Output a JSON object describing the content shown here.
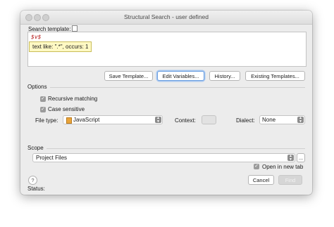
{
  "window": {
    "title": "Structural Search - user defined"
  },
  "template": {
    "label": "Search template:",
    "text": "$v$",
    "tooltip": "text like: \".*\", occurs: 1"
  },
  "buttons": {
    "save_template": "Save Template...",
    "edit_variables": "Edit Variables...",
    "history": "History...",
    "existing_templates": "Existing Templates..."
  },
  "options": {
    "header": "Options",
    "recursive_matching": {
      "label": "Recursive matching",
      "checked": true
    },
    "case_sensitive": {
      "label": "Case sensitive",
      "checked": true
    },
    "file_type": {
      "label": "File type:",
      "value": "JavaScript"
    },
    "context": {
      "label": "Context:",
      "value": ""
    },
    "dialect": {
      "label": "Dialect:",
      "value": "None"
    }
  },
  "scope": {
    "header": "Scope",
    "value": "Project Files",
    "browse": "...",
    "open_in_new_tab": {
      "label": "Open in new tab",
      "checked": true
    }
  },
  "footer": {
    "help": "?",
    "cancel": "Cancel",
    "find": "Find",
    "status_label": "Status:"
  }
}
